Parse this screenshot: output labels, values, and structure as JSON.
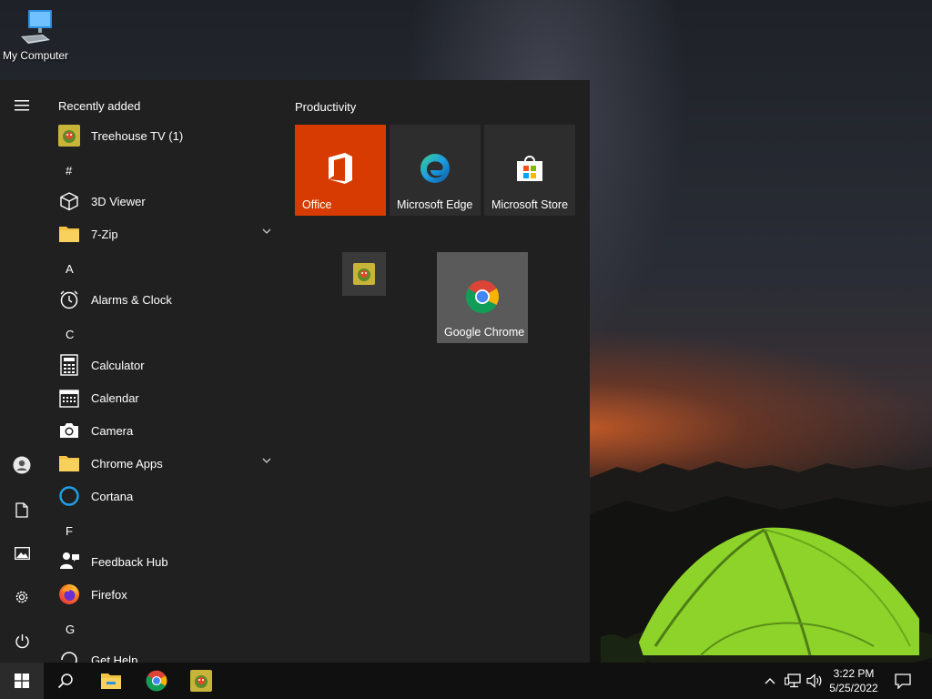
{
  "desktop": {
    "icon_label": "My Computer"
  },
  "start_menu": {
    "section_title": "Recently added",
    "apps": [
      {
        "label": "Treehouse TV (1)",
        "icon": "treehouse-icon"
      },
      {
        "letter": "#"
      },
      {
        "label": "3D Viewer",
        "icon": "cube-icon"
      },
      {
        "label": "7-Zip",
        "icon": "folder-icon",
        "expandable": true
      },
      {
        "letter": "A"
      },
      {
        "label": "Alarms & Clock",
        "icon": "alarm-clock-icon"
      },
      {
        "letter": "C"
      },
      {
        "label": "Calculator",
        "icon": "calculator-icon"
      },
      {
        "label": "Calendar",
        "icon": "calendar-icon"
      },
      {
        "label": "Camera",
        "icon": "camera-icon"
      },
      {
        "label": "Chrome Apps",
        "icon": "folder-icon",
        "expandable": true
      },
      {
        "label": "Cortana",
        "icon": "cortana-icon"
      },
      {
        "letter": "F"
      },
      {
        "label": "Feedback Hub",
        "icon": "feedback-icon"
      },
      {
        "label": "Firefox",
        "icon": "firefox-icon"
      },
      {
        "letter": "G"
      },
      {
        "label": "Get Help",
        "icon": "help-icon"
      }
    ],
    "group_title": "Productivity",
    "tiles": [
      {
        "label": "Office",
        "color": "#d83b01"
      },
      {
        "label": "Microsoft Edge",
        "color": "#2d2d2d"
      },
      {
        "label": "Microsoft Store",
        "color": "#2d2d2d"
      },
      {
        "label": "",
        "color": "#3a3a3a"
      },
      {
        "label": "Google Chrome",
        "color": "#5a5a5a"
      }
    ]
  },
  "taskbar": {
    "time": "3:22 PM",
    "date": "5/25/2022"
  }
}
